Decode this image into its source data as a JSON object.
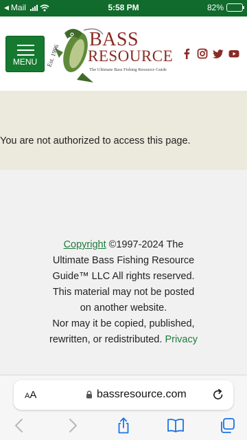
{
  "status_bar": {
    "back_label": "Mail",
    "time": "5:58 PM",
    "battery_percent": "82%",
    "battery_level": 0.82
  },
  "header": {
    "menu_label": "MENU",
    "logo_word_1": "BASS",
    "logo_word_2": "RESOURCE",
    "logo_tagline": "The Ultimate Bass Fishing Resource Guide",
    "logo_est": "Est. 1996",
    "social_icons": [
      "facebook-icon",
      "instagram-icon",
      "twitter-icon",
      "youtube-icon"
    ],
    "brand_color": "#157a30",
    "social_color": "#8a2b25"
  },
  "main": {
    "message": "You are not authorized to access this page."
  },
  "footer": {
    "copyright_link": "Copyright",
    "copyright_text": " ©1997-2024 The Ultimate Bass Fishing Resource Guide™ LLC All rights reserved.",
    "line_2": "This material may not be posted on another website.",
    "line_3": "Nor may it be copied, published, rewritten, or redistributed. ",
    "privacy_link": "Privacy"
  },
  "browser": {
    "text_size_label": "AA",
    "url": "bassresource.com",
    "toolbar_icons": [
      "back-icon",
      "forward-icon",
      "share-icon",
      "bookmarks-icon",
      "tabs-icon"
    ]
  }
}
